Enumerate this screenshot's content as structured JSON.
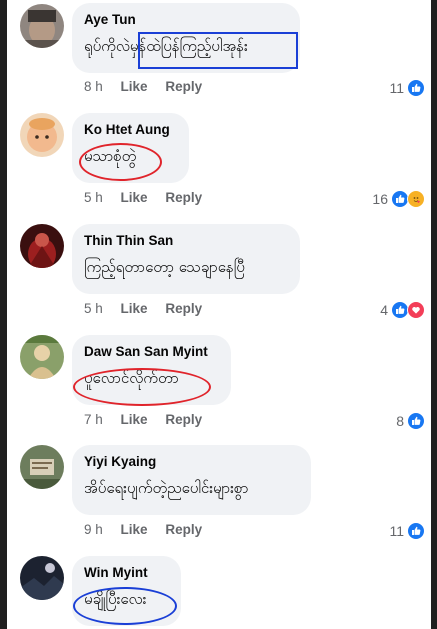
{
  "labels": {
    "like": "Like",
    "reply": "Reply"
  },
  "colors": {
    "like_blue": "#1877f2",
    "love_red": "#f33e58",
    "care_yellow": "#f7b125",
    "bubble_bg": "#f0f2f5",
    "meta_gray": "#65676b",
    "mark_red": "#e0242b",
    "mark_blue": "#1a3fd6"
  },
  "comments": [
    {
      "author": "Aye Tun",
      "text_a": "ရုပ်ကိုလဲ",
      "text_b": "မှန်ထဲပြန်ကြည့်ပါအုန်း",
      "time": "8 h",
      "count": "11",
      "reactions": [
        "like-icon"
      ],
      "mark": "blue-rectangle"
    },
    {
      "author": "Ko Htet Aung",
      "text": "မသာစုံတွဲ",
      "time": "5 h",
      "count": "16",
      "reactions": [
        "like-icon",
        "care-icon"
      ],
      "mark": "red-oval"
    },
    {
      "author": "Thin Thin San",
      "text": "ကြည့်ရတာတော့ သေချာနေပြီ",
      "time": "5 h",
      "count": "4",
      "reactions": [
        "like-icon",
        "love-icon"
      ],
      "mark": "none"
    },
    {
      "author": "Daw San San Myint",
      "text": "ပူလောင်လိုက်တာ",
      "time": "7 h",
      "count": "8",
      "reactions": [
        "like-icon"
      ],
      "mark": "red-oval"
    },
    {
      "author": "Yiyi Kyaing",
      "text": "အိပ်ရေးပျက်တဲ့ညပေါင်းများစွာ",
      "time": "9 h",
      "count": "11",
      "reactions": [
        "like-icon"
      ],
      "mark": "none"
    },
    {
      "author": "Win Myint",
      "text": "မချိုပြီးလေး",
      "mark": "blue-oval"
    }
  ]
}
